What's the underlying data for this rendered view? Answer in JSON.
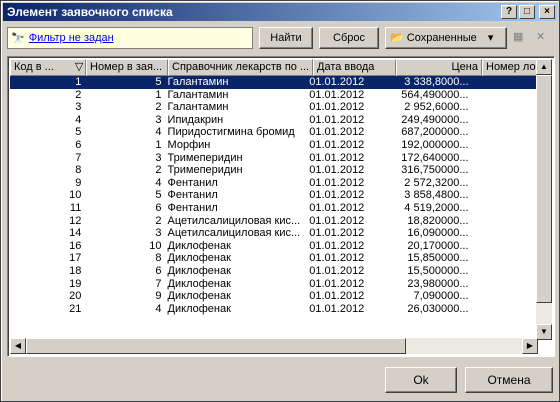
{
  "window": {
    "title": "Элемент заявочного списка"
  },
  "toolbar": {
    "filter_label": "Фильтр не задан",
    "find_label": "Найти",
    "reset_label": "Сброс",
    "saved_label": "Сохраненные"
  },
  "table": {
    "headers": [
      "Код в ...",
      "Номер в зая...",
      "Справочник лекарств по ...",
      "Дата ввода",
      "Цена",
      "Номер ло"
    ],
    "rows": [
      [
        "1",
        "5",
        "Галантамин",
        "01.01.2012",
        "3 338,8000..."
      ],
      [
        "2",
        "1",
        "Галантамин",
        "01.01.2012",
        "564,490000..."
      ],
      [
        "3",
        "2",
        "Галантамин",
        "01.01.2012",
        "2 952,6000..."
      ],
      [
        "4",
        "3",
        "Ипидакрин",
        "01.01.2012",
        "249,490000..."
      ],
      [
        "5",
        "4",
        "Пиридостигмина бромид",
        "01.01.2012",
        "687,200000..."
      ],
      [
        "6",
        "1",
        "Морфин",
        "01.01.2012",
        "192,000000..."
      ],
      [
        "7",
        "3",
        "Тримеперидин",
        "01.01.2012",
        "172,640000..."
      ],
      [
        "8",
        "2",
        "Тримеперидин",
        "01.01.2012",
        "316,750000..."
      ],
      [
        "9",
        "4",
        "Фентанил",
        "01.01.2012",
        "2 572,3200..."
      ],
      [
        "10",
        "5",
        "Фентанил",
        "01.01.2012",
        "3 858,4800..."
      ],
      [
        "11",
        "6",
        "Фентанил",
        "01.01.2012",
        "4 519,2000..."
      ],
      [
        "12",
        "2",
        "Ацетилсалициловая кис...",
        "01.01.2012",
        "18,820000..."
      ],
      [
        "14",
        "3",
        "Ацетилсалициловая кис...",
        "01.01.2012",
        "16,090000..."
      ],
      [
        "16",
        "10",
        "Диклофенак",
        "01.01.2012",
        "20,170000..."
      ],
      [
        "17",
        "8",
        "Диклофенак",
        "01.01.2012",
        "15,850000..."
      ],
      [
        "18",
        "6",
        "Диклофенак",
        "01.01.2012",
        "15,500000..."
      ],
      [
        "19",
        "7",
        "Диклофенак",
        "01.01.2012",
        "23,980000..."
      ],
      [
        "20",
        "9",
        "Диклофенак",
        "01.01.2012",
        "7,090000..."
      ],
      [
        "21",
        "4",
        "Диклофенак",
        "01.01.2012",
        "26,030000..."
      ]
    ]
  },
  "footer": {
    "ok_label": "Ok",
    "cancel_label": "Отмена"
  }
}
